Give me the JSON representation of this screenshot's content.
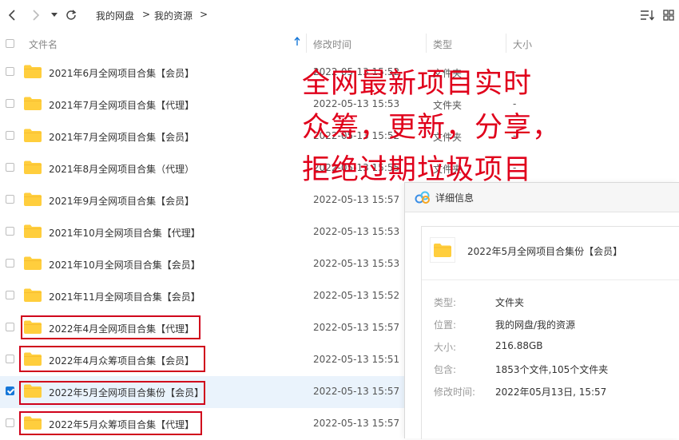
{
  "breadcrumb": [
    "我的网盘",
    ">",
    "我的资源",
    ">"
  ],
  "header": {
    "name": "文件名",
    "modified": "修改时间",
    "type": "类型",
    "size": "大小"
  },
  "files": [
    {
      "name": "2021年6月全网项目合集【会员】",
      "date": "2022-05-13 15:52",
      "type": "文件夹",
      "size": "-",
      "checked": false,
      "highlight": false
    },
    {
      "name": "2021年7月全网项目合集【代理】",
      "date": "2022-05-13 15:53",
      "type": "文件夹",
      "size": "-",
      "checked": false,
      "highlight": false
    },
    {
      "name": "2021年7月全网项目合集【会员】",
      "date": "2022-05-13 15:52",
      "type": "文件夹",
      "size": "-",
      "checked": false,
      "highlight": false
    },
    {
      "name": "2021年8月全网项目合集（代理）",
      "date": "2022-05-13 15:55",
      "type": "文件夹",
      "size": "-",
      "checked": false,
      "highlight": false
    },
    {
      "name": "2021年9月全网项目合集【会员】",
      "date": "2022-05-13 15:57",
      "type": "",
      "size": "",
      "checked": false,
      "highlight": false
    },
    {
      "name": "2021年10月全网项目合集【代理】",
      "date": "2022-05-13 15:53",
      "type": "",
      "size": "",
      "checked": false,
      "highlight": false
    },
    {
      "name": "2021年10月全网项目合集【会员】",
      "date": "2022-05-13 15:53",
      "type": "",
      "size": "",
      "checked": false,
      "highlight": false
    },
    {
      "name": "2021年11月全网项目合集【会员】",
      "date": "2022-05-13 15:52",
      "type": "",
      "size": "",
      "checked": false,
      "highlight": false
    },
    {
      "name": "2022年4月全网项目合集【代理】",
      "date": "2022-05-13 15:57",
      "type": "",
      "size": "",
      "checked": false,
      "highlight": true
    },
    {
      "name": "2022年4月众筹项目合集【会员】",
      "date": "2022-05-13 15:51",
      "type": "",
      "size": "",
      "checked": false,
      "highlight": true
    },
    {
      "name": "2022年5月全网项目合集份【会员】",
      "date": "2022-05-13 15:57",
      "type": "",
      "size": "",
      "checked": true,
      "highlight": true
    },
    {
      "name": "2022年5月众筹项目合集【代理】",
      "date": "2022-05-13 15:57",
      "type": "",
      "size": "",
      "checked": false,
      "highlight": true
    }
  ],
  "overlay_text": [
    "全网最新项目实时",
    "众筹，更新，分享，",
    "拒绝过期垃圾项目"
  ],
  "details": {
    "title": "详细信息",
    "name": "2022年5月全网项目合集份【会员】",
    "rows": [
      {
        "label": "类型:",
        "value": "文件夹"
      },
      {
        "label": "位置:",
        "value": "我的网盘/我的资源"
      },
      {
        "label": "大小:",
        "value": "216.88GB"
      },
      {
        "label": "包含:",
        "value": "1853个文件,105个文件夹"
      },
      {
        "label": "修改时间:",
        "value": "2022年05月13日, 15:57"
      }
    ]
  },
  "colors": {
    "folder": "#FFCE3D",
    "accent": "#1677D8",
    "highlight_border": "#D0021B",
    "overlay_text": "#E0001B",
    "selected_row": "#EAF3FC"
  }
}
